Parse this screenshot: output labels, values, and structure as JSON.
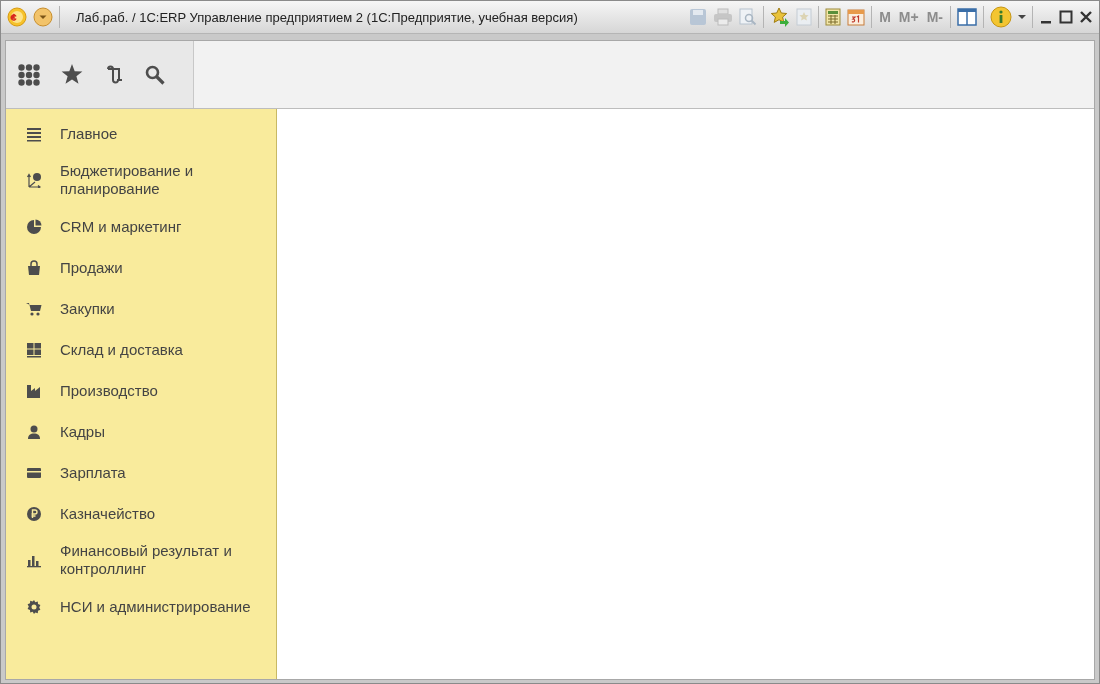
{
  "window": {
    "title": "Лаб.раб. / 1С:ERP Управление предприятием 2  (1С:Предприятие, учебная версия)"
  },
  "memory_buttons": [
    {
      "label": "M",
      "disabled": true
    },
    {
      "label": "M+",
      "disabled": true
    },
    {
      "label": "M-",
      "disabled": true
    }
  ],
  "sections": [
    {
      "label": "Главное"
    },
    {
      "label": "Бюджетирование и планирование"
    },
    {
      "label": "CRM и маркетинг"
    },
    {
      "label": "Продажи"
    },
    {
      "label": "Закупки"
    },
    {
      "label": "Склад и доставка"
    },
    {
      "label": "Производство"
    },
    {
      "label": "Кадры"
    },
    {
      "label": "Зарплата"
    },
    {
      "label": "Казначейство"
    },
    {
      "label": "Финансовый результат и контроллинг"
    },
    {
      "label": "НСИ и администрирование"
    }
  ]
}
